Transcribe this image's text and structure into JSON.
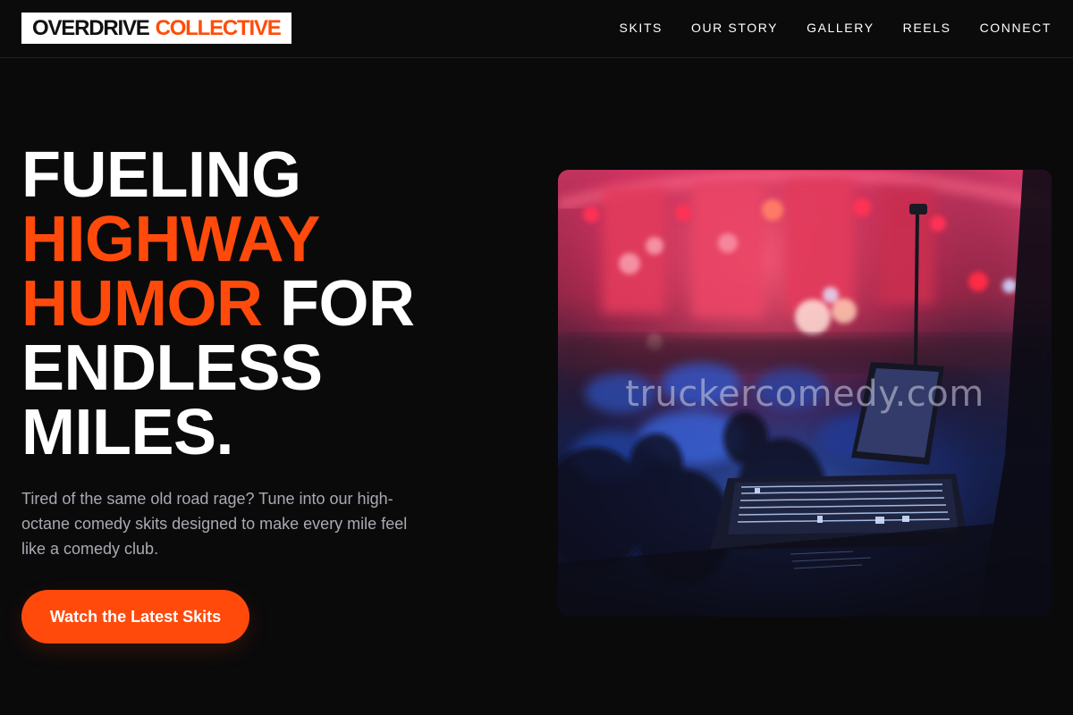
{
  "brand": {
    "part1": "OVERDRIVE",
    "part2": "COLLECTIVE"
  },
  "nav": {
    "items": [
      {
        "label": "SKITS"
      },
      {
        "label": "OUR STORY"
      },
      {
        "label": "GALLERY"
      },
      {
        "label": "REELS"
      },
      {
        "label": "CONNECT"
      }
    ]
  },
  "hero": {
    "headline": {
      "line1": "FUELING",
      "line2": "HIGHWAY",
      "line3a": "HUMOR",
      "line3b": "FOR",
      "line4": "ENDLESS",
      "line5": "MILES."
    },
    "description": "Tired of the same old road rage? Tune into our high-octane comedy skits designed to make every mile feel like a comedy club.",
    "cta_label": "Watch the Latest Skits"
  },
  "image": {
    "watermark": "truckercomedy.com"
  },
  "colors": {
    "accent": "#ff4a0c",
    "background": "#0a0a0b",
    "text": "#ffffff",
    "muted_text": "#a9aab2"
  }
}
